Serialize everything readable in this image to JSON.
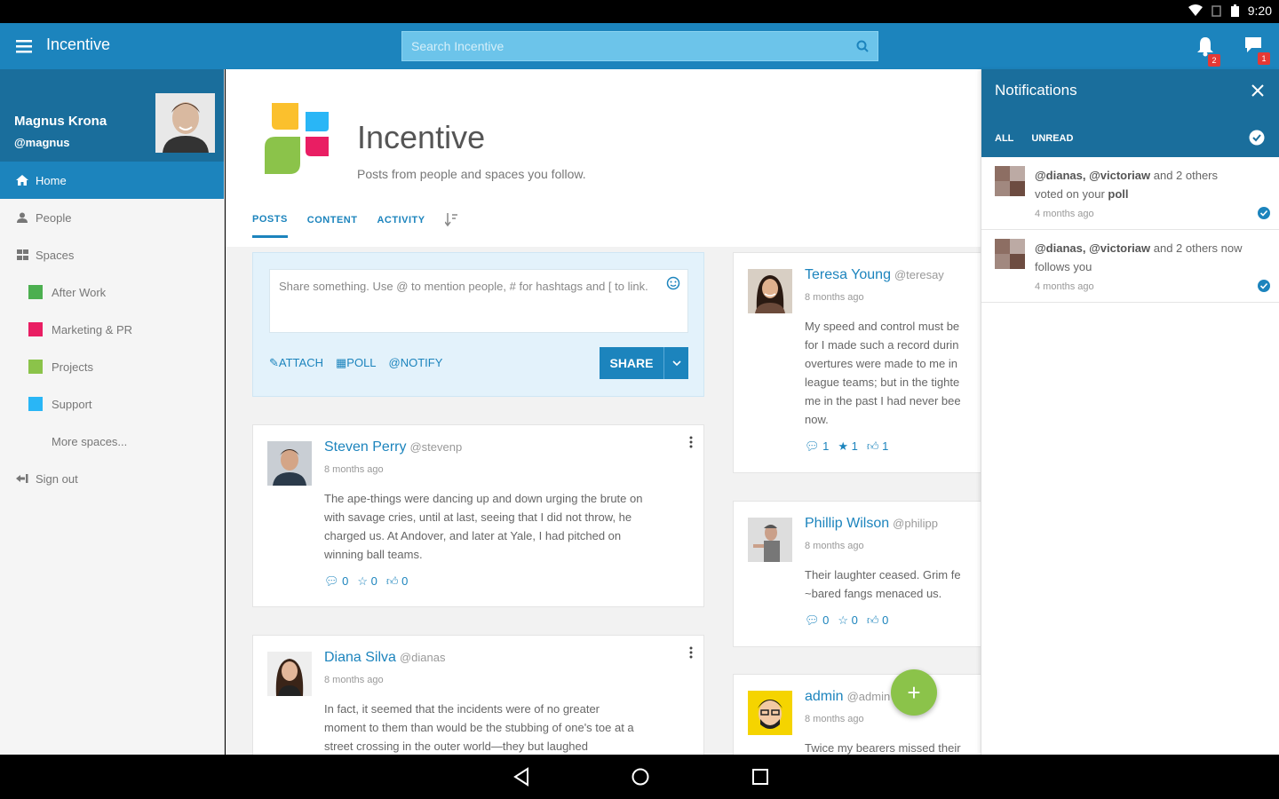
{
  "status_bar": {
    "time": "9:20"
  },
  "appbar": {
    "title": "Incentive",
    "search_placeholder": "Search Incentive",
    "notifications_badge": "2",
    "messages_badge": "1"
  },
  "sidebar": {
    "user_name": "Magnus Krona",
    "user_handle": "@magnus",
    "items": [
      {
        "label": "Home"
      },
      {
        "label": "People"
      },
      {
        "label": "Spaces"
      },
      {
        "label": "After Work",
        "color": "#4caf50"
      },
      {
        "label": "Marketing & PR",
        "color": "#e91e63"
      },
      {
        "label": "Projects",
        "color": "#8bc34a"
      },
      {
        "label": "Support",
        "color": "#29b6f6"
      },
      {
        "label": "More spaces..."
      },
      {
        "label": "Sign out"
      }
    ]
  },
  "main": {
    "title": "Incentive",
    "subtitle": "Posts from people and spaces you follow.",
    "tabs": [
      {
        "label": "POSTS"
      },
      {
        "label": "CONTENT"
      },
      {
        "label": "ACTIVITY"
      }
    ],
    "composer": {
      "placeholder": "Share something. Use @ to mention people, # for hashtags and [ to link.",
      "attach": "ATTACH",
      "poll": "POLL",
      "notify": "NOTIFY",
      "share": "SHARE"
    },
    "posts": [
      {
        "author": "Steven Perry",
        "handle": "@stevenp",
        "time": "8 months ago",
        "lines": [
          "The ape-things were dancing up and down urging the brute on",
          "with savage cries, until at last, seeing that I did not throw, he",
          "charged us. At Andover, and later at Yale, I had pitched on",
          "winning ball teams."
        ],
        "comments": "0",
        "stars": "0",
        "likes": "0"
      },
      {
        "author": "Diana Silva",
        "handle": "@dianas",
        "time": "8 months ago",
        "lines": [
          "In fact, it seemed that the incidents were of no greater",
          "moment to them than would be the stubbing of one's toe at a",
          "street crossing in the outer world—they but laughed"
        ]
      },
      {
        "author": "Teresa Young",
        "handle": "@teresay",
        "time": "8 months ago",
        "lines": [
          "My speed and control must be",
          "for I made such a record durin",
          "overtures were made to me in",
          "league teams; but in the tighte",
          "me in the past I had never bee",
          "now."
        ],
        "comments": "1",
        "stars": "1",
        "likes": "1"
      },
      {
        "author": "Phillip Wilson",
        "handle": "@philipp",
        "time": "8 months ago",
        "lines": [
          "Their laughter ceased. Grim fe",
          "~bared fangs menaced us."
        ],
        "comments": "0",
        "stars": "0",
        "likes": "0"
      },
      {
        "author": "admin",
        "handle": "@admin",
        "time": "8 months ago",
        "lines": [
          "Twice my bearers missed their"
        ]
      }
    ]
  },
  "notifications": {
    "title": "Notifications",
    "filter_all": "ALL",
    "filter_unread": "UNREAD",
    "items": [
      {
        "users": "@dianas, @victoriaw",
        "rest": " and 2 others voted on your ",
        "target": "poll",
        "time": "4 months ago"
      },
      {
        "users": "@dianas, @victoriaw",
        "rest": " and 2 others now follows you",
        "target": "",
        "time": "4 months ago"
      }
    ]
  },
  "colors": {
    "primary": "#1c84bd",
    "primary_dark": "#1a6e9c",
    "fab": "#8bc34a",
    "badge": "#e53935"
  },
  "icons": [
    "menu-icon",
    "search-icon",
    "bell-icon",
    "chat-icon",
    "home-icon",
    "person-icon",
    "grid-icon",
    "sign-out-icon",
    "sort-icon",
    "smile-icon",
    "paperclip-icon",
    "poll-icon",
    "at-icon",
    "chevron-down-icon",
    "kebab-icon",
    "comment-icon",
    "star-icon",
    "thumbs-up-icon",
    "close-icon",
    "check-circle-icon",
    "plus-icon"
  ]
}
